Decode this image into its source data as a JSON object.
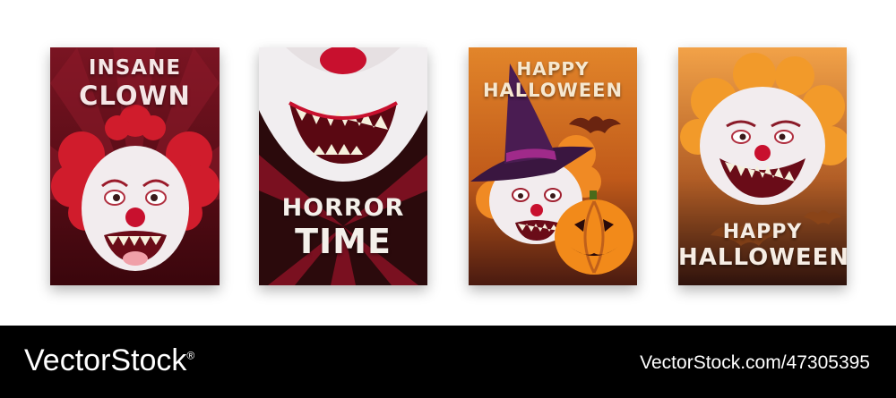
{
  "posters": [
    {
      "line1": "INSANE",
      "line2": "CLOWN"
    },
    {
      "line1": "HORROR",
      "line2": "TIME"
    },
    {
      "line1": "HAPPY",
      "line2": "HALLOWEEN"
    },
    {
      "line1": "HAPPY",
      "line2": "HALLOWEEN"
    }
  ],
  "footer": {
    "brand": "VectorStock",
    "brand_suffix": "®",
    "image_id": "VectorStock.com/47305395"
  },
  "colors": {
    "clown_red": "#c8102e",
    "pumpkin_orange": "#f28a1a",
    "dark_red": "#3a060c",
    "title_text": "#f5e6e6"
  },
  "icons": [
    "clown-face-icon",
    "clown-mouth-icon",
    "witch-hat-icon",
    "bat-icon",
    "pumpkin-icon"
  ]
}
